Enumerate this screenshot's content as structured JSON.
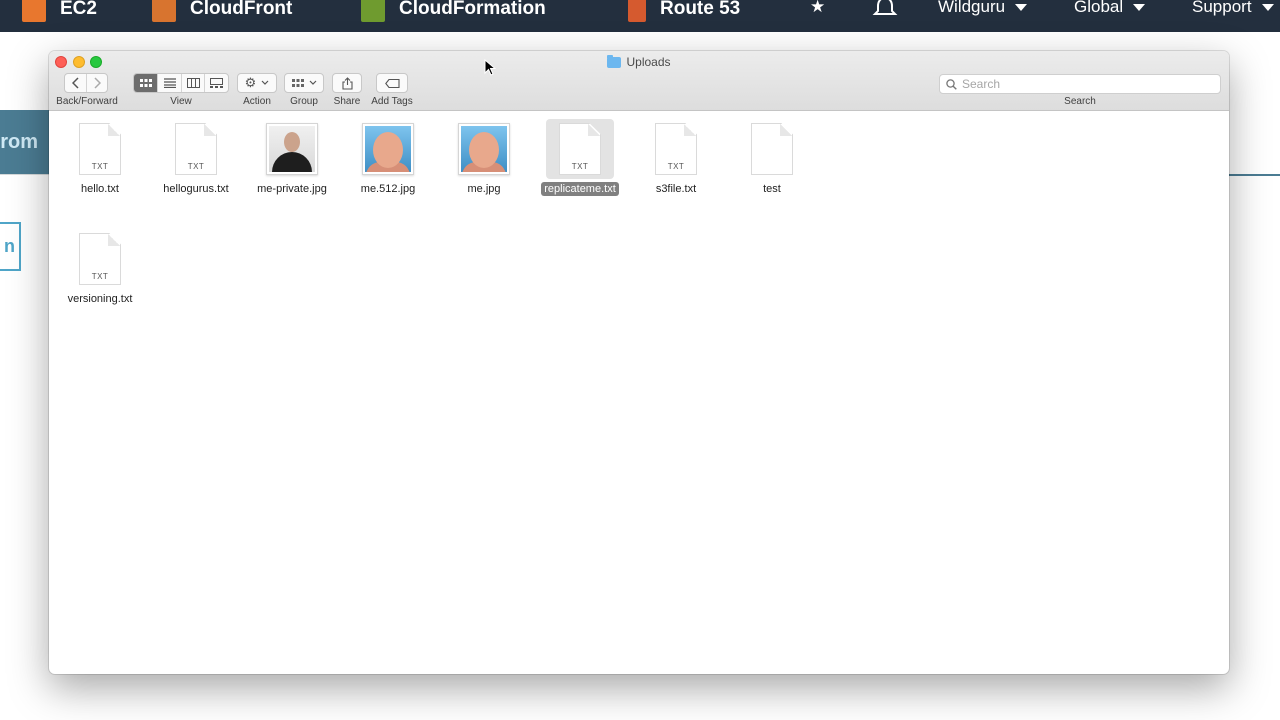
{
  "aws_nav": {
    "services": [
      {
        "label": "EC2",
        "color": "#e8772e"
      },
      {
        "label": "CloudFront",
        "color": "#d8742f"
      },
      {
        "label": "CloudFormation",
        "color": "#6f9b2f"
      },
      {
        "label": "Route 53",
        "color": "#d55a2f"
      }
    ],
    "account": "Wildguru",
    "region": "Global",
    "support": "Support"
  },
  "aws_bg": {
    "left_band_text": "rom",
    "left_button_text": "n"
  },
  "finder": {
    "title": "Uploads",
    "toolbar": {
      "back_forward": "Back/Forward",
      "view": "View",
      "action": "Action",
      "group": "Group",
      "share": "Share",
      "add_tags": "Add Tags",
      "search_label": "Search",
      "search_placeholder": "Search"
    },
    "files": [
      {
        "name": "hello.txt",
        "kind": "doc",
        "ext": "TXT"
      },
      {
        "name": "hellogurus.txt",
        "kind": "doc",
        "ext": "TXT"
      },
      {
        "name": "me-private.jpg",
        "kind": "photo-dark"
      },
      {
        "name": "me.512.jpg",
        "kind": "photo-blue"
      },
      {
        "name": "me.jpg",
        "kind": "photo-blue"
      },
      {
        "name": "replicateme.txt",
        "kind": "doc",
        "ext": "TXT",
        "selected": true
      },
      {
        "name": "s3file.txt",
        "kind": "doc",
        "ext": "TXT"
      },
      {
        "name": "test",
        "kind": "doc",
        "ext": ""
      },
      {
        "name": "versioning.txt",
        "kind": "doc",
        "ext": "TXT"
      }
    ]
  }
}
